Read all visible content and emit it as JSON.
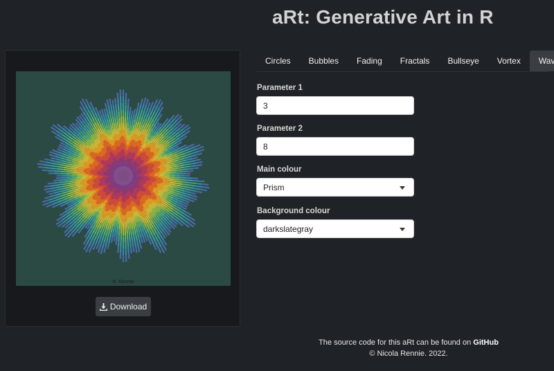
{
  "header": {
    "title": "aRt: Generative Art in R"
  },
  "art": {
    "signature": "N. Rennie",
    "background_color": "#2b4a44"
  },
  "download": {
    "label": "Download",
    "icon": "download-icon"
  },
  "tabs": [
    {
      "label": "Circles",
      "active": false
    },
    {
      "label": "Bubbles",
      "active": false
    },
    {
      "label": "Fading",
      "active": false
    },
    {
      "label": "Fractals",
      "active": false
    },
    {
      "label": "Bullseye",
      "active": false
    },
    {
      "label": "Vortex",
      "active": false
    },
    {
      "label": "Waves",
      "active": true
    }
  ],
  "form": {
    "param1": {
      "label": "Parameter 1",
      "value": "3"
    },
    "param2": {
      "label": "Parameter 2",
      "value": "8"
    },
    "main_colour": {
      "label": "Main colour",
      "value": "Prism"
    },
    "background_colour": {
      "label": "Background colour",
      "value": "darkslategray"
    }
  },
  "footer": {
    "line1_prefix": "The source code for this aRt can be found on ",
    "line1_link": "GitHub",
    "line2": "© Nicola Rennie. 2022."
  },
  "colors": {
    "page_bg": "#1f2227",
    "panel_bg": "#17191c",
    "active_tab_bg": "#3a3d42",
    "prism": [
      "#5f4690",
      "#1d6996",
      "#38a6a5",
      "#0f8554",
      "#73af48",
      "#edad08",
      "#e17c05",
      "#cc503e",
      "#94346e",
      "#6f4070"
    ]
  }
}
